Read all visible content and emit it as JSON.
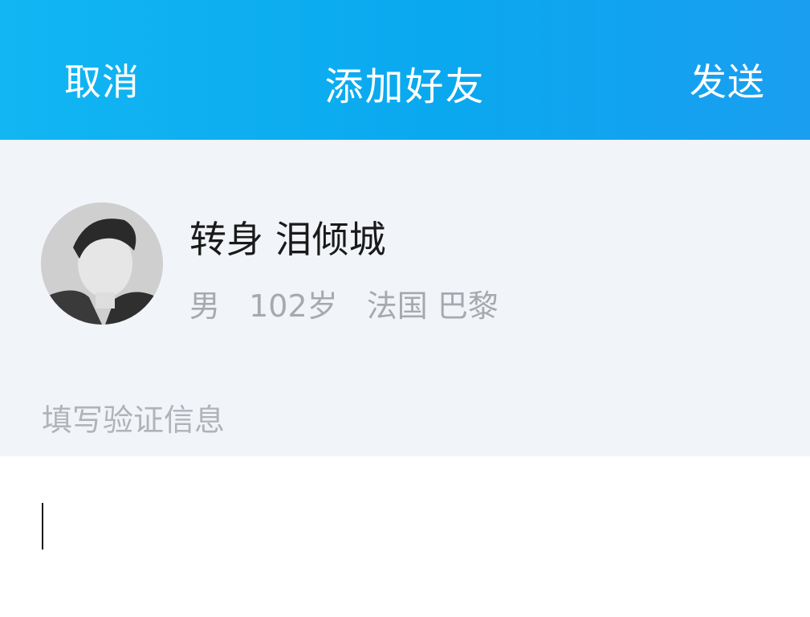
{
  "header": {
    "cancel_label": "取消",
    "title": "添加好友",
    "send_label": "发送"
  },
  "profile": {
    "name": "转身 泪倾城",
    "gender": "男",
    "age": "102岁",
    "location": "法国 巴黎"
  },
  "verification": {
    "label": "填写验证信息",
    "value": ""
  },
  "colors": {
    "header_start": "#12b6f2",
    "header_end": "#1a9ef0",
    "background": "#f1f4f8"
  }
}
